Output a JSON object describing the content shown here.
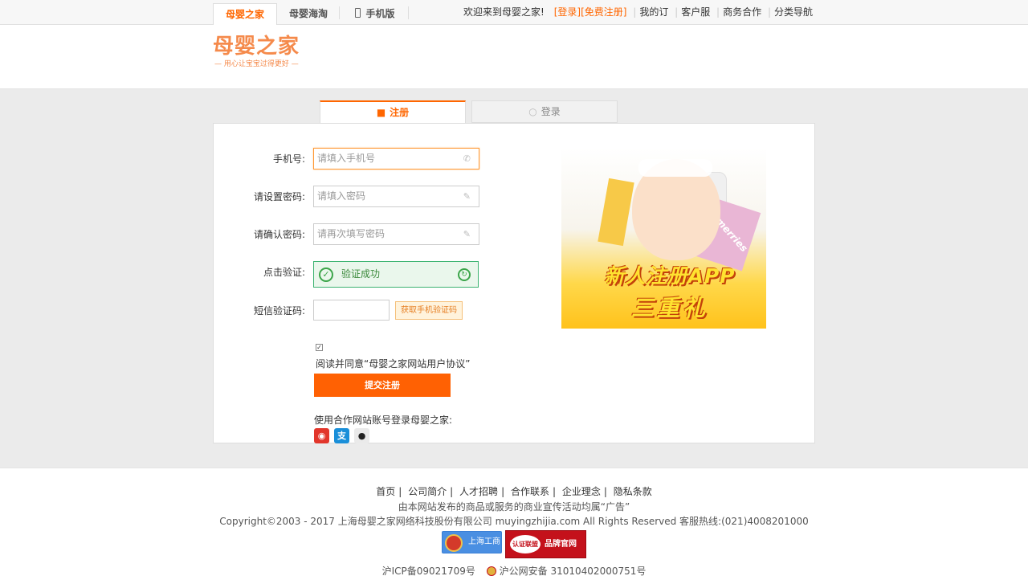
{
  "topbar": {
    "tabs": [
      {
        "label": "母婴之家"
      },
      {
        "label": "母婴海淘"
      },
      {
        "label": "手机版"
      }
    ],
    "welcome": "欢迎来到母婴之家!",
    "login_link": "[登录]",
    "register_link": "[免费注册]",
    "links": [
      "我的订",
      "客户服",
      "商务合作",
      "分类导航"
    ]
  },
  "header": {
    "logo_text": "母婴之家",
    "logo_tagline": "— 用心让宝宝过得更好 —"
  },
  "form_tabs": {
    "register": "注册",
    "login": "登录"
  },
  "form": {
    "phone_label": "手机号:",
    "phone_placeholder": "请填入手机号",
    "password_label": "请设置密码:",
    "password_placeholder": "请填入密码",
    "confirm_label": "请确认密码:",
    "confirm_placeholder": "请再次填写密码",
    "verify_label": "点击验证:",
    "verify_status": "验证成功",
    "sms_label": "短信验证码:",
    "sms_value": "",
    "sms_button": "获取手机验证码",
    "agree_checked": true,
    "agree_text": "阅读并同意“母婴之家网站用户协议”",
    "submit": "提交注册",
    "partner_text": "使用合作网站账号登录母婴之家:",
    "partner_icons": [
      "weibo-icon",
      "alipay-icon",
      "qq-icon"
    ]
  },
  "banner": {
    "line1": "新人注册APP",
    "line2": "三重礼",
    "brand_on_pack": "merries"
  },
  "footer": {
    "links": [
      "首页",
      "公司简介",
      "人才招聘",
      "合作联系",
      "企业理念",
      "隐私条款"
    ],
    "note": "由本网站发布的商品或服务的商业宣传活动均属“广告”",
    "copyright": "Copyright©2003 - 2017 上海母婴之家网络科技股份有限公司 muyingzhijia.com All Rights Reserved 客服热线:(021)4008201000",
    "badge1": "上海工商",
    "badge2_seal": "认证联盟",
    "badge2": "品牌官网",
    "icp": "沪ICP备09021709号",
    "police": "沪公网安备 31010402000751号"
  },
  "colors": {
    "accent": "#ff6600",
    "submit": "#ff6103",
    "success": "#3ca54a"
  }
}
